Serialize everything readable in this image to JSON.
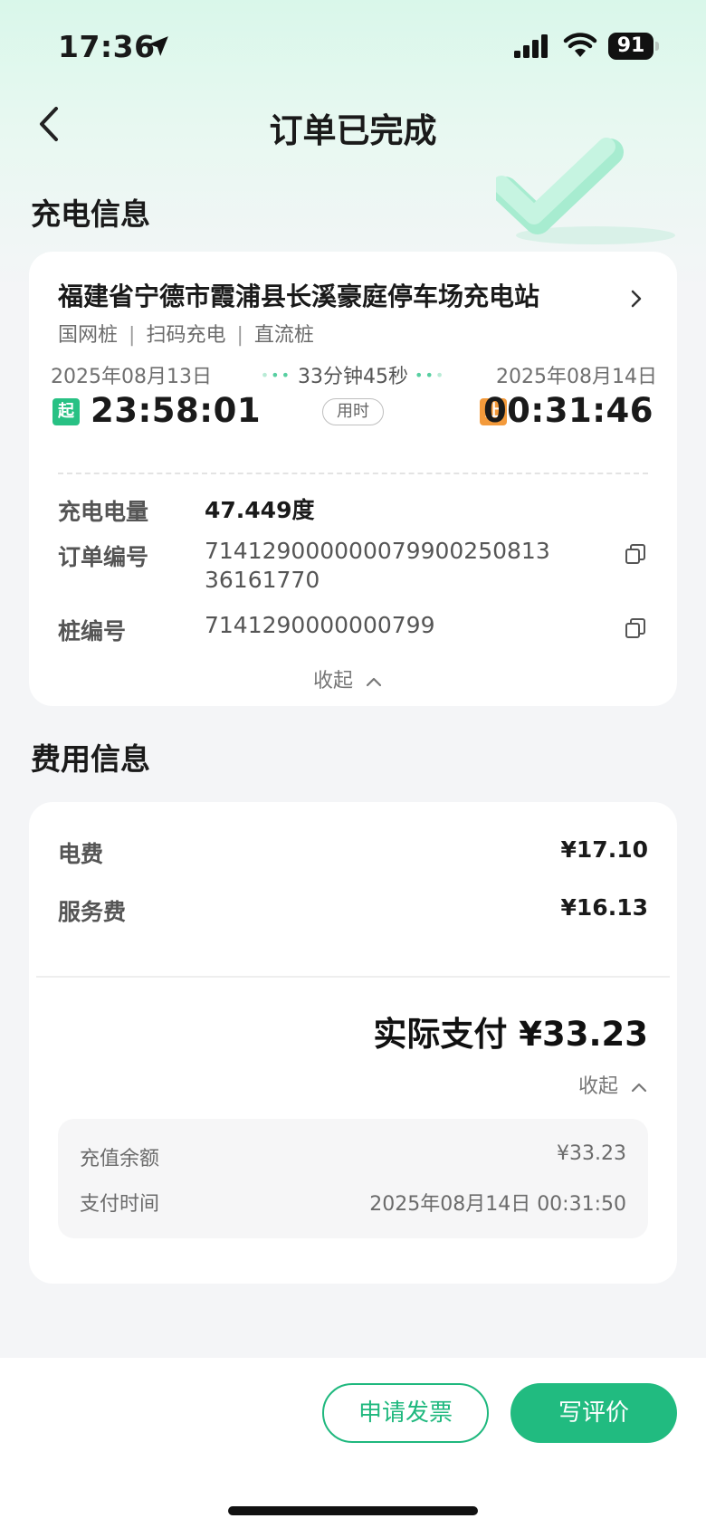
{
  "status_bar": {
    "time": "17:36",
    "battery": "91"
  },
  "nav": {
    "title": "订单已完成"
  },
  "charging": {
    "section_title": "充电信息",
    "station_name": "福建省宁德市霞浦县长溪豪庭停车场充电站",
    "tags": [
      "国网桩",
      "扫码充电",
      "直流桩"
    ],
    "start_date": "2025年08月13日",
    "end_date": "2025年08月14日",
    "duration": "33分钟45秒",
    "used_label": "用时",
    "start_badge": "起",
    "end_badge": "止",
    "start_time": "23:58:01",
    "end_time": "00:31:46",
    "energy_label": "充电电量",
    "energy_value": "47.449度",
    "order_label": "订单编号",
    "order_value_line1": "7141290000000799002508​13",
    "order_value_line2": "36161770",
    "pile_label": "桩编号",
    "pile_value": "7141290000000799",
    "collapse_label": "收起"
  },
  "fees": {
    "section_title": "费用信息",
    "electric_label": "电费",
    "electric_value": "¥17.10",
    "service_label": "服务费",
    "service_value": "¥16.13",
    "total_label": "实际支付 ¥33.23",
    "collapse_label": "收起",
    "balance_label": "充值余额",
    "balance_value": "¥33.23",
    "pay_time_label": "支付时间",
    "pay_time_value": "2025年08月14日 00:31:50"
  },
  "actions": {
    "invoice_label": "申请发票",
    "review_label": "写评价"
  },
  "colors": {
    "accent": "#21bb80",
    "start_badge": "#28c184",
    "end_badge": "#f39a3b"
  }
}
